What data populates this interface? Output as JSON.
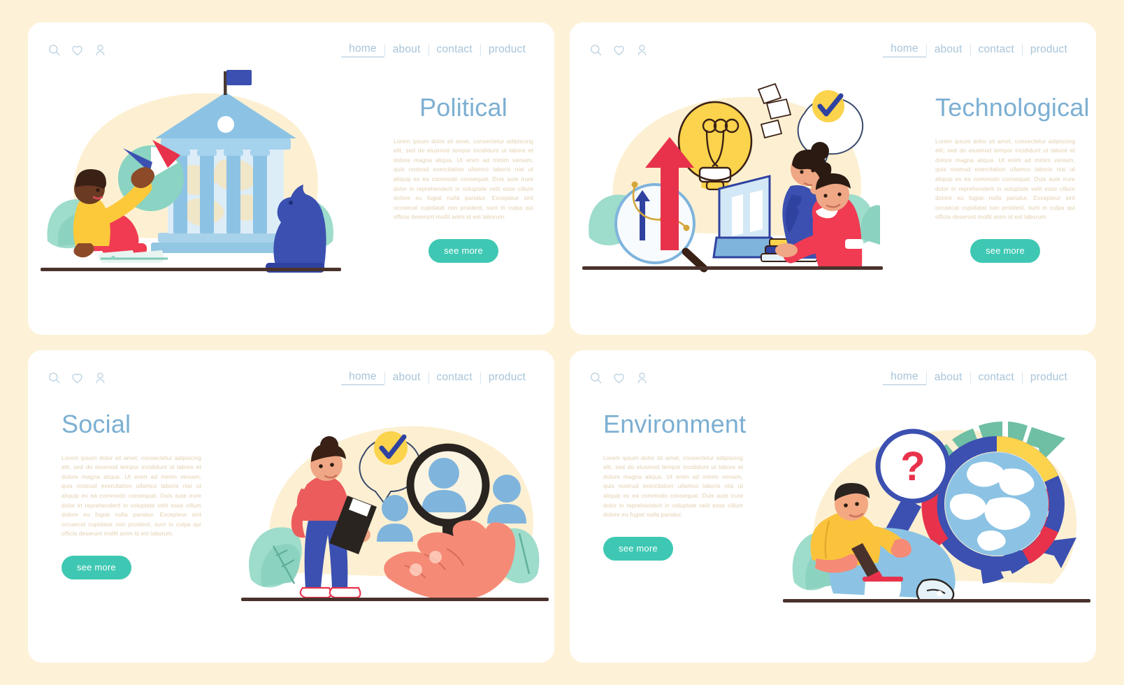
{
  "meta": {
    "page_background": "#FDF2D8",
    "panel_background": "#FFFFFF",
    "title_color": "#7CAFD2",
    "body_text_color": "#E2CFAE",
    "button_color": "#3EC8B3",
    "nav_color": "#A8C4D8"
  },
  "nav": {
    "icons": [
      "search-icon",
      "heart-icon",
      "user-icon"
    ],
    "links": [
      {
        "label": "home",
        "active": true
      },
      {
        "label": "about",
        "active": false
      },
      {
        "label": "contact",
        "active": false
      },
      {
        "label": "product",
        "active": false
      }
    ]
  },
  "panels": [
    {
      "id": "political",
      "title": "Political",
      "body": "Lorem ipsum dolor sit amet, consectetur adipiscing elit, sed do eiusmod tempor incididunt ut labore et dolore magna aliqua. Ut enim ad minim veniam, quis nostrud exercitation ullamco laboris nisi ut aliquip ex ea commodo consequat. Duis aute irure dolor in reprehenderit in voluptate velit esse cillum dolore eu fugiat nulla pariatur. Excepteur sint occaecat cupidatat non proident, sunt in culpa qui officia deserunt mollit anim id est laborum.",
      "button": "see more",
      "layout": "right-text",
      "illustration": "government-building-pie-chart-chess-knight"
    },
    {
      "id": "technological",
      "title": "Technological",
      "body": "Lorem ipsum dolor sit amet, consectetur adipiscing elit, sed do eiusmod tempor incididunt ut labore et dolore magna aliqua. Ut enim ad minim veniam, quis nostrud exercitation ullamco laboris nisi ut aliquip ex ea commodo consequat. Duis aute irure dolor in reprehenderit in voluptate velit esse cillum dolore eu fugiat nulla pariatur. Excepteur sint occaecat cupidatat non proident, sunt in culpa qui officia deserunt mollit anim id est laborum.",
      "button": "see more",
      "layout": "right-text",
      "illustration": "lightbulb-laptop-team-magnifier-arrows"
    },
    {
      "id": "social",
      "title": "Social",
      "body": "Lorem ipsum dolor sit amet, consectetur adipiscing elit, sed do eiusmod tempor incididunt ut labore et dolore magna aliqua. Ut enim ad minim veniam, quis nostrud exercitation ullamco laboris nisi ut aliquip ex ea commodo consequat. Duis aute irure dolor in reprehenderit in voluptate velit esse cillum dolore eu fugiat nulla pariatur. Excepteur sint occaecat cupidatat non proident, sunt in culpa qui officia deserunt mollit anim id est laborum.",
      "button": "see more",
      "layout": "left-text",
      "illustration": "woman-clipboard-hand-magnifier-user-avatars"
    },
    {
      "id": "environment",
      "title": "Environment",
      "body": "Lorem ipsum dolor sit amet, consectetur adipiscing elit, sed do eiusmod tempor incididunt ut labore et dolore magna aliqua. Ut enim ad minim veniam, quis nostrud exercitation ullamco laboris nisi ut aliquip ex ea commodo consequat. Duis aute irure dolor in reprehenderit in voluptate velit esse cillum dolore eu fugiat nulla pariatur.",
      "button": "see more",
      "layout": "left-text",
      "illustration": "man-magnifier-question-globe-arrow-ring"
    }
  ]
}
